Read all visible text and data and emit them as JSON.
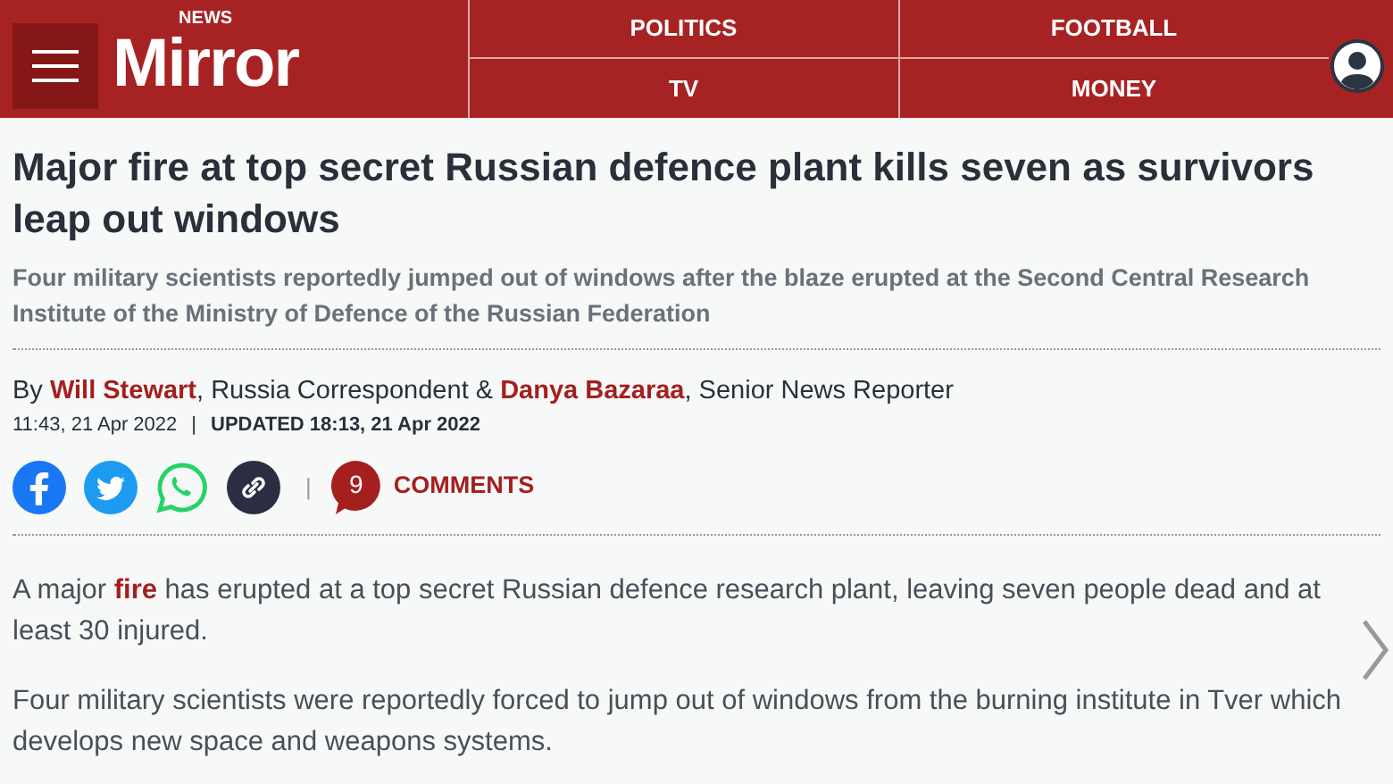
{
  "header": {
    "logo_top": "NEWS",
    "logo": "Mirror",
    "nav": [
      {
        "label": "POLITICS"
      },
      {
        "label": "FOOTBALL"
      },
      {
        "label": "TV"
      },
      {
        "label": "MONEY"
      }
    ]
  },
  "article": {
    "headline": "Major fire at top secret Russian defence plant kills seven as survivors leap out windows",
    "standfirst": "Four military scientists reportedly jumped out of windows after the blaze erupted at the Second Central Research Institute of the Ministry of Defence of the Russian Federation",
    "byline": [
      {
        "kind": "text",
        "text": "By "
      },
      {
        "kind": "link",
        "text": "Will Stewart"
      },
      {
        "kind": "text",
        "text": ", Russia Correspondent & "
      },
      {
        "kind": "link",
        "text": "Danya Bazaraa"
      },
      {
        "kind": "text",
        "text": ", Senior News Reporter"
      }
    ],
    "published": "11:43, 21 Apr 2022",
    "updated": "UPDATED 18:13, 21 Apr 2022",
    "separator": "|",
    "share_separator": "|",
    "comment_count": "9",
    "comments_label": "COMMENTS",
    "paragraphs": [
      {
        "before": "A major ",
        "link": "fire",
        "after": " has erupted at a top secret Russian defence research plant, leaving seven people dead and at least 30 injured."
      },
      {
        "before": "Four military scientists were reportedly forced to jump out of windows from the burning institute in Tver which develops new space and weapons systems."
      }
    ]
  }
}
